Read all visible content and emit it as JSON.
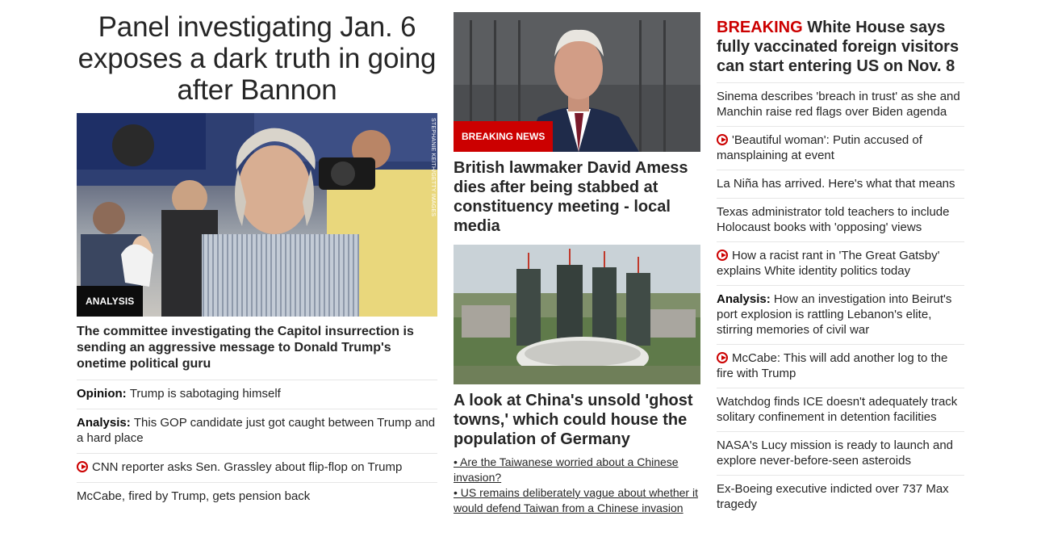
{
  "col1": {
    "headline": "Panel investigating Jan. 6 exposes a dark truth in going after Bannon",
    "image_badge": "ANALYSIS",
    "image_credit": "STEPHANIE KEITH/GETTY IMAGES",
    "description": "The committee investigating the Capitol insurrection is sending an aggressive message to Donald Trump's onetime political guru",
    "items": [
      {
        "prefix": "Opinion:",
        "text": "Trump is sabotaging himself",
        "video": false
      },
      {
        "prefix": "Analysis:",
        "text": "This GOP candidate just got caught between Trump and a hard place",
        "video": false
      },
      {
        "prefix": "",
        "text": "CNN reporter asks Sen. Grassley about flip-flop on Trump",
        "video": true
      },
      {
        "prefix": "",
        "text": "McCabe, fired by Trump, gets pension back",
        "video": false
      }
    ]
  },
  "col2": {
    "amess_badge": "BREAKING NEWS",
    "amess_title": "British lawmaker David Amess dies after being stabbed at constituency meeting - local media",
    "china_title": "A look at China's unsold 'ghost towns,' which could house the population of Germany",
    "bullets": [
      "• Are the Taiwanese worried about a Chinese invasion?",
      "• US remains deliberately vague about whether it would defend Taiwan from a Chinese invasion"
    ]
  },
  "col3": {
    "breaking_keyword": "BREAKING",
    "breaking_text": " White House says fully vaccinated foreign visitors can start entering US on Nov. 8",
    "items": [
      {
        "prefix": "",
        "text": "Sinema describes 'breach in trust' as she and Manchin raise red flags over Biden agenda",
        "video": false
      },
      {
        "prefix": "",
        "text": "'Beautiful woman': Putin accused of mansplaining at event",
        "video": true
      },
      {
        "prefix": "",
        "text": "La Niña has arrived. Here's what that means",
        "video": false
      },
      {
        "prefix": "",
        "text": "Texas administrator told teachers to include Holocaust books with 'opposing' views",
        "video": false
      },
      {
        "prefix": "",
        "text": "How a racist rant in 'The Great Gatsby' explains White identity politics today",
        "video": true
      },
      {
        "prefix": "Analysis:",
        "text": "How an investigation into Beirut's port explosion is rattling Lebanon's elite, stirring memories of civil war",
        "video": false
      },
      {
        "prefix": "",
        "text": "McCabe: This will add another log to the fire with Trump",
        "video": true
      },
      {
        "prefix": "",
        "text": "Watchdog finds ICE doesn't adequately track solitary confinement in detention facilities",
        "video": false
      },
      {
        "prefix": "",
        "text": "NASA's Lucy mission is ready to launch and explore never-before-seen asteroids",
        "video": false
      },
      {
        "prefix": "",
        "text": "Ex-Boeing executive indicted over 737 Max tragedy",
        "video": false
      }
    ]
  },
  "colors": {
    "breaking_red": "#cc0000",
    "badge_dark": "#0c0c0c",
    "divider": "#e6e6e6"
  }
}
